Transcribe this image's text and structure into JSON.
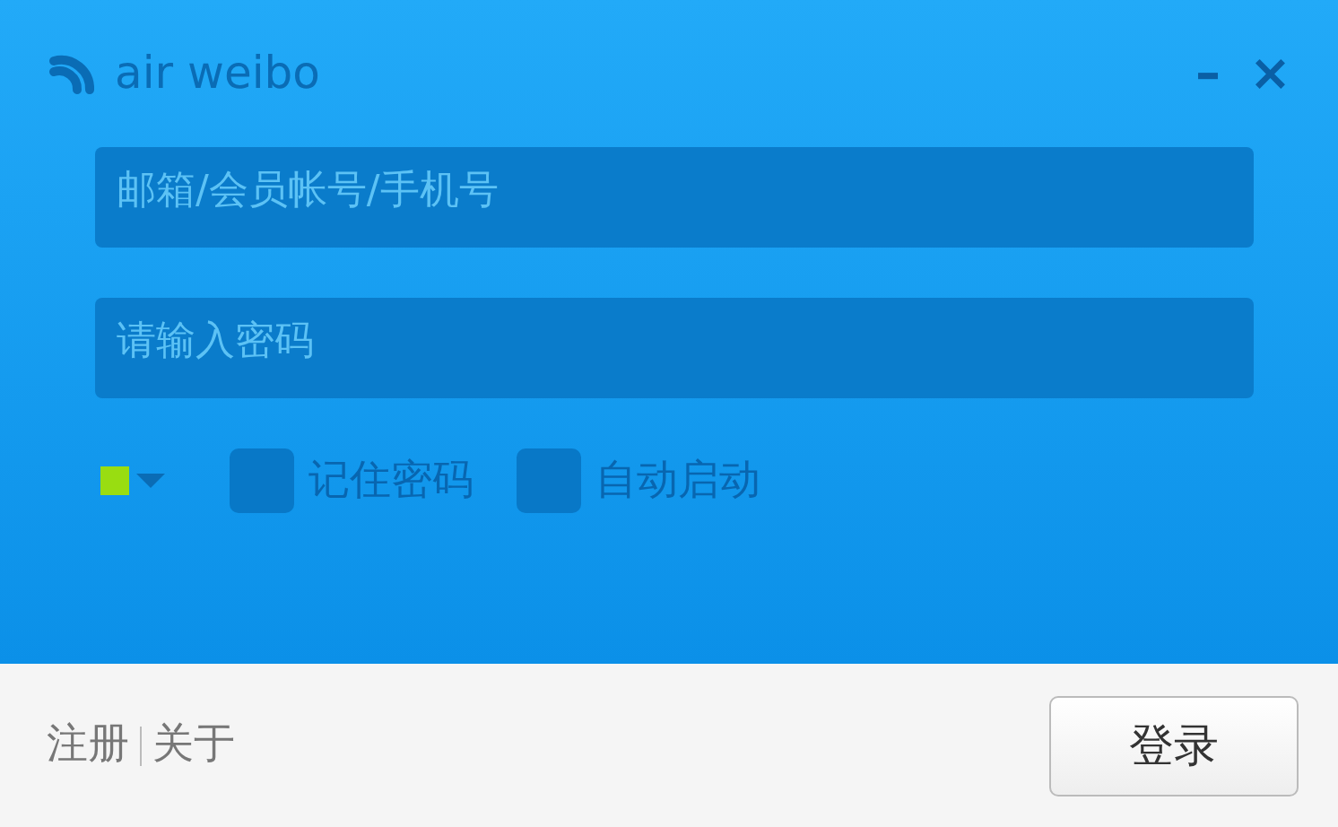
{
  "window": {
    "title": "air weibo",
    "controls": [
      "–",
      "×"
    ]
  },
  "fields": [
    {
      "placeholder": "邮箱/会员帐号/手机号"
    },
    {
      "placeholder": "请输入密码"
    }
  ],
  "status": {
    "color": "#99dd11"
  },
  "options": [
    {
      "label": "记住密码",
      "checked": false
    },
    {
      "label": "自动启动",
      "checked": false
    }
  ],
  "footer": {
    "links": [
      "注册",
      "关于"
    ],
    "button": "登录"
  }
}
